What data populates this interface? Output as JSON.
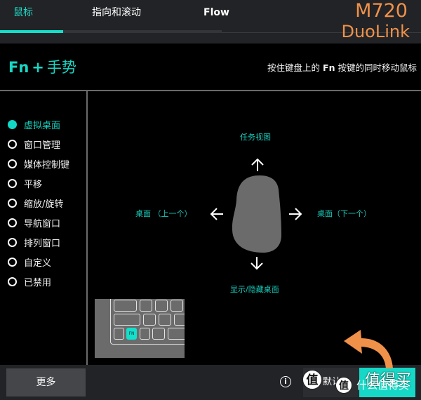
{
  "tabs": [
    {
      "label": "鼠标",
      "active": true
    },
    {
      "label": "指向和滚动",
      "active": false
    },
    {
      "label": "Flow",
      "active": false
    }
  ],
  "brand": {
    "model": "M720",
    "subtitle": "DuoLink"
  },
  "heading": {
    "fn": "Fn",
    "plus": "+",
    "title": "手势"
  },
  "hint": {
    "before": "按住键盘上的",
    "key": "Fn",
    "after": "按键的同时移动鼠标"
  },
  "options": [
    {
      "label": "虚拟桌面",
      "selected": true
    },
    {
      "label": "窗口管理",
      "selected": false
    },
    {
      "label": "媒体控制键",
      "selected": false
    },
    {
      "label": "平移",
      "selected": false
    },
    {
      "label": "缩放/旋转",
      "selected": false
    },
    {
      "label": "导航窗口",
      "selected": false
    },
    {
      "label": "排列窗口",
      "selected": false
    },
    {
      "label": "自定义",
      "selected": false
    },
    {
      "label": "已禁用",
      "selected": false
    }
  ],
  "gestures": {
    "up": "任务视图",
    "left": "桌面 （上一个）",
    "right": "桌面（下一个）",
    "down": "显示/隐藏桌面"
  },
  "keyboard": {
    "fn_key": "FN"
  },
  "footer": {
    "more_label": "更多",
    "info_icon": "i",
    "default_label": "默认",
    "apply_label": ""
  },
  "watermark": {
    "badge": "值",
    "text": "值得买",
    "text2": "什么值得买"
  },
  "colors": {
    "accent": "#13e0cc",
    "brand": "#f0914a",
    "bar": "#222326",
    "mouse": "#6b6b6b"
  }
}
